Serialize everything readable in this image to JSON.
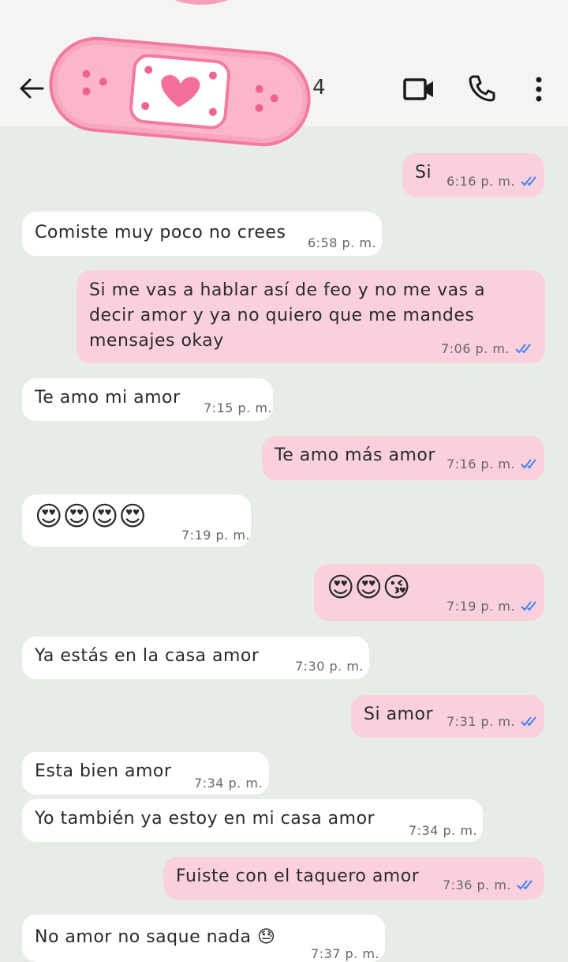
{
  "header": {
    "partial_number": "4",
    "icons": [
      "back-arrow-icon",
      "video-call-icon",
      "phone-call-icon",
      "more-vert-icon"
    ],
    "sticker": "pink-bandage-heart-sticker"
  },
  "messages": [
    {
      "dir": "out",
      "text": "Si",
      "time": "6:16 p. m."
    },
    {
      "dir": "in",
      "text": "Comiste muy poco no crees",
      "time": "6:58 p. m."
    },
    {
      "dir": "out",
      "text": "Si me vas a hablar así de feo y no me vas a decir amor y ya no quiero que me mandes mensajes okay",
      "time": "7:06 p. m."
    },
    {
      "dir": "in",
      "text": "Te amo mi amor",
      "time": "7:15 p. m."
    },
    {
      "dir": "out",
      "text": "Te amo más amor",
      "time": "7:16 p. m."
    },
    {
      "dir": "in",
      "text": "😍😍😍😍",
      "time": "7:19 p. m."
    },
    {
      "dir": "out",
      "text": "😍😍😘",
      "time": "7:19 p. m."
    },
    {
      "dir": "in",
      "text": "Ya estás en la casa amor",
      "time": "7:30 p. m."
    },
    {
      "dir": "out",
      "text": "Si amor",
      "time": "7:31 p. m."
    },
    {
      "dir": "in",
      "text": "Esta bien amor",
      "time": "7:34 p. m."
    },
    {
      "dir": "in",
      "text": "Yo también ya estoy en mi casa amor",
      "time": "7:34 p. m."
    },
    {
      "dir": "out",
      "text": "Fuiste con el taquero amor",
      "time": "7:36 p. m."
    },
    {
      "dir": "in",
      "text": "No amor no saque nada 😓",
      "time": "7:37 p. m."
    }
  ],
  "colors": {
    "incoming": "#ffffff",
    "outgoing": "#fbd0dd",
    "background": "#e7ece6",
    "ticks": "#3b82f6"
  }
}
